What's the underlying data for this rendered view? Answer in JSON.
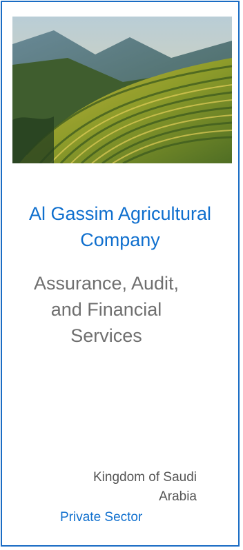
{
  "company": {
    "line1": "Al Gassim Agricultural",
    "line2": "Company"
  },
  "service": {
    "line1": "Assurance, Audit,",
    "line2": "and Financial",
    "line3": "Services"
  },
  "location": {
    "line1": "Kingdom of Saudi",
    "line2": "Arabia"
  },
  "sector": "Private Sector",
  "image": {
    "subject": "terraced-rice-fields-photo"
  },
  "colors": {
    "border": "#1a6cc4",
    "accent_text": "#0f6fce",
    "muted_text": "#6f6f6f"
  }
}
